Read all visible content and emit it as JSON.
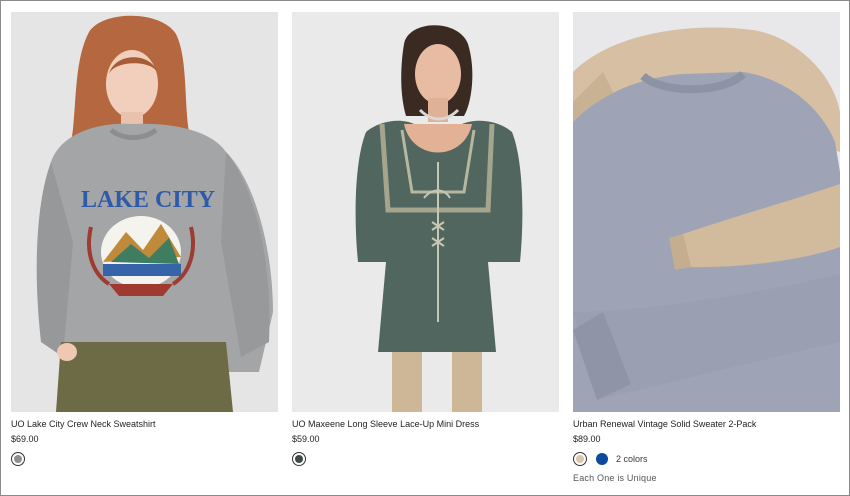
{
  "products": [
    {
      "name": "UO Lake City Crew Neck Sweatshirt",
      "price": "$69.00",
      "graphic_text": "LAKE CITY",
      "swatches": [
        {
          "color": "#8e8e8e",
          "selected": true
        }
      ]
    },
    {
      "name": "UO Maxeene Long Sleeve Lace-Up Mini Dress",
      "price": "$59.00",
      "swatches": [
        {
          "color": "#3d4a45",
          "selected": true
        }
      ]
    },
    {
      "name": "Urban Renewal Vintage Solid Sweater 2-Pack",
      "price": "$89.00",
      "swatches": [
        {
          "color": "#d9c6ad",
          "selected": true
        },
        {
          "color": "#0c4a9b",
          "selected": false
        }
      ],
      "colors_count": "2 colors",
      "note": "Each One is Unique"
    }
  ]
}
